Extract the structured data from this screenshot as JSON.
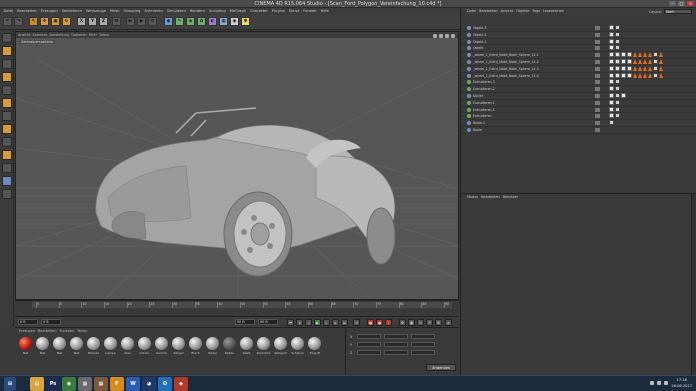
{
  "window": {
    "title": "CINEMA 4D R15.064 Studio - [Scan_Ford_Polygon_Vereinfachung_10.c4d *]",
    "controls": [
      "–",
      "□",
      "✕"
    ]
  },
  "menubar": [
    "Datei",
    "Bearbeiten",
    "Erzeugen",
    "Selektieren",
    "Werkzeuge",
    "Mesh",
    "Snapping",
    "Animieren",
    "Simulieren",
    "Rendern",
    "Sculpting",
    "MoGraph",
    "Charakter",
    "Plugins",
    "Skript",
    "Fenster",
    "Hilfe"
  ],
  "toolbar": {
    "axis_buttons": [
      "X",
      "Y",
      "Z"
    ]
  },
  "viewport": {
    "menu": [
      "Ansicht",
      "Kameras",
      "Darstellung",
      "Optionen",
      "Filter",
      "Tafeln"
    ],
    "camera_label": "Zentralperspektive"
  },
  "timeline": {
    "ticks": [
      "0",
      "5",
      "10",
      "15",
      "20",
      "25",
      "30",
      "35",
      "40",
      "45",
      "50",
      "55",
      "60",
      "65",
      "70",
      "75",
      "80",
      "85",
      "90"
    ]
  },
  "transport": {
    "start_field": "0 B",
    "current_field": "0 B",
    "end_field": "90 B",
    "max_field": "90 B",
    "frame_readout": "0 B"
  },
  "material_manager": {
    "menu": [
      "Erzeugen",
      "Bearbeiten",
      "Funktion",
      "Textur"
    ],
    "materials": [
      {
        "label": "Mat",
        "tone": "red"
      },
      {
        "label": "Mat",
        "tone": "light"
      },
      {
        "label": "Mat",
        "tone": "light"
      },
      {
        "label": "Mat",
        "tone": "light"
      },
      {
        "label": "Polierte",
        "tone": "light"
      },
      {
        "label": "Lampe",
        "tone": "light"
      },
      {
        "label": "Glas",
        "tone": "light"
      },
      {
        "label": "Chrom",
        "tone": "light"
      },
      {
        "label": "Gummi",
        "tone": "light"
      },
      {
        "label": "Sängel",
        "tone": "light"
      },
      {
        "label": "Blech",
        "tone": "light"
      },
      {
        "label": "Rädel",
        "tone": "light"
      },
      {
        "label": "Reifen",
        "tone": "dark"
      },
      {
        "label": "Stahl",
        "tone": "light"
      },
      {
        "label": "Rücklicht",
        "tone": "light"
      },
      {
        "label": "Kühlgrill",
        "tone": "light"
      },
      {
        "label": "Scheinw",
        "tone": "light"
      },
      {
        "label": "Türgriff",
        "tone": "light"
      }
    ]
  },
  "coordinates": {
    "rows": [
      "X",
      "Y",
      "Z"
    ],
    "apply_label": "Anwenden"
  },
  "object_manager": {
    "menu": [
      "Datei",
      "Bearbeiten",
      "Ansicht",
      "Objekte",
      "Tags",
      "Lesezeichen"
    ],
    "layout_label": "Layout:",
    "layout_value": "Start",
    "objects": [
      {
        "name": "Objekt.3",
        "icon": "#6f8fc0",
        "tags": [
          "phong",
          "check"
        ]
      },
      {
        "name": "Objekt.2",
        "icon": "#6f8fc0",
        "tags": [
          "phong",
          "check"
        ]
      },
      {
        "name": "Objekt.1",
        "icon": "#6f8fc0",
        "tags": [
          "phong",
          "check"
        ]
      },
      {
        "name": "Objekt",
        "icon": "#6f8fc0",
        "tags": [
          "phong",
          "check"
        ]
      },
      {
        "name": "_wheel_1_Extrd_Nobil_Nobil_Sphere_14.1",
        "icon": "#6f8fc0",
        "tags": [
          "phong",
          "phong",
          "phong",
          "phong",
          "warn",
          "warn",
          "warn",
          "warn",
          "check",
          "warn"
        ]
      },
      {
        "name": "_wheel_1_Extrd_Nobil_Nobil_Sphere_14.2",
        "icon": "#6f8fc0",
        "tags": [
          "phong",
          "phong",
          "phong",
          "phong",
          "warn",
          "warn",
          "warn",
          "warn",
          "check",
          "warn"
        ]
      },
      {
        "name": "_wheel_1_Extrd_Nobil_Nobil_Sphere_14.3",
        "icon": "#6f8fc0",
        "tags": [
          "phong",
          "phong",
          "phong",
          "phong",
          "warn",
          "warn",
          "warn",
          "warn",
          "check",
          "warn"
        ]
      },
      {
        "name": "_wheel_1_Extrd_Nobil_Nobil_Sphere_14.4",
        "icon": "#6f8fc0",
        "tags": [
          "phong",
          "phong",
          "phong",
          "phong",
          "warn",
          "warn",
          "warn",
          "warn",
          "check",
          "warn"
        ]
      },
      {
        "name": "Extrudieren.3",
        "icon": "#5fb05f",
        "tags": [
          "phong",
          "check"
        ]
      },
      {
        "name": "Extrudieren.2",
        "icon": "#5fb05f",
        "tags": [
          "phong",
          "check"
        ]
      },
      {
        "name": "Kühler",
        "icon": "#6f8fc0",
        "tags": [
          "phong",
          "check",
          "phong"
        ]
      },
      {
        "name": "Extrudieren.1",
        "icon": "#5fb05f",
        "tags": [
          "phong",
          "check"
        ]
      },
      {
        "name": "Extrudieren.1",
        "icon": "#5fb05f",
        "tags": [
          "phong",
          "check"
        ]
      },
      {
        "name": "Extrudieren",
        "icon": "#5fb05f",
        "tags": [
          "phong",
          "check"
        ]
      },
      {
        "name": "Boole.1",
        "icon": "#6f8fc0",
        "tags": [
          "check"
        ]
      },
      {
        "name": "Boole",
        "icon": "#6f8fc0",
        "tags": []
      }
    ]
  },
  "attribute_manager": {
    "menu": [
      "Modus",
      "Bearbeiten",
      "Benutzer"
    ]
  },
  "taskbar": {
    "apps": [
      {
        "name": "explorer",
        "label": "▤",
        "color": "#d9a43a"
      },
      {
        "name": "photoshop",
        "label": "Ps",
        "color": "#1a2c52"
      },
      {
        "name": "chrome",
        "label": "◉",
        "color": "#3d7a3d"
      },
      {
        "name": "app4",
        "label": "▦",
        "color": "#6a6a6a"
      },
      {
        "name": "app5",
        "label": "▦",
        "color": "#7a5a3a"
      },
      {
        "name": "app6",
        "label": "F",
        "color": "#d58a1a"
      },
      {
        "name": "word",
        "label": "W",
        "color": "#2a5bb5"
      },
      {
        "name": "cinema4d",
        "label": "◕",
        "color": "#1e3a6a"
      },
      {
        "name": "outlook",
        "label": "O",
        "color": "#1f6fbf"
      },
      {
        "name": "app10",
        "label": "◆",
        "color": "#b33a2a"
      }
    ],
    "time": "17:18",
    "date": "26.06.2017"
  }
}
